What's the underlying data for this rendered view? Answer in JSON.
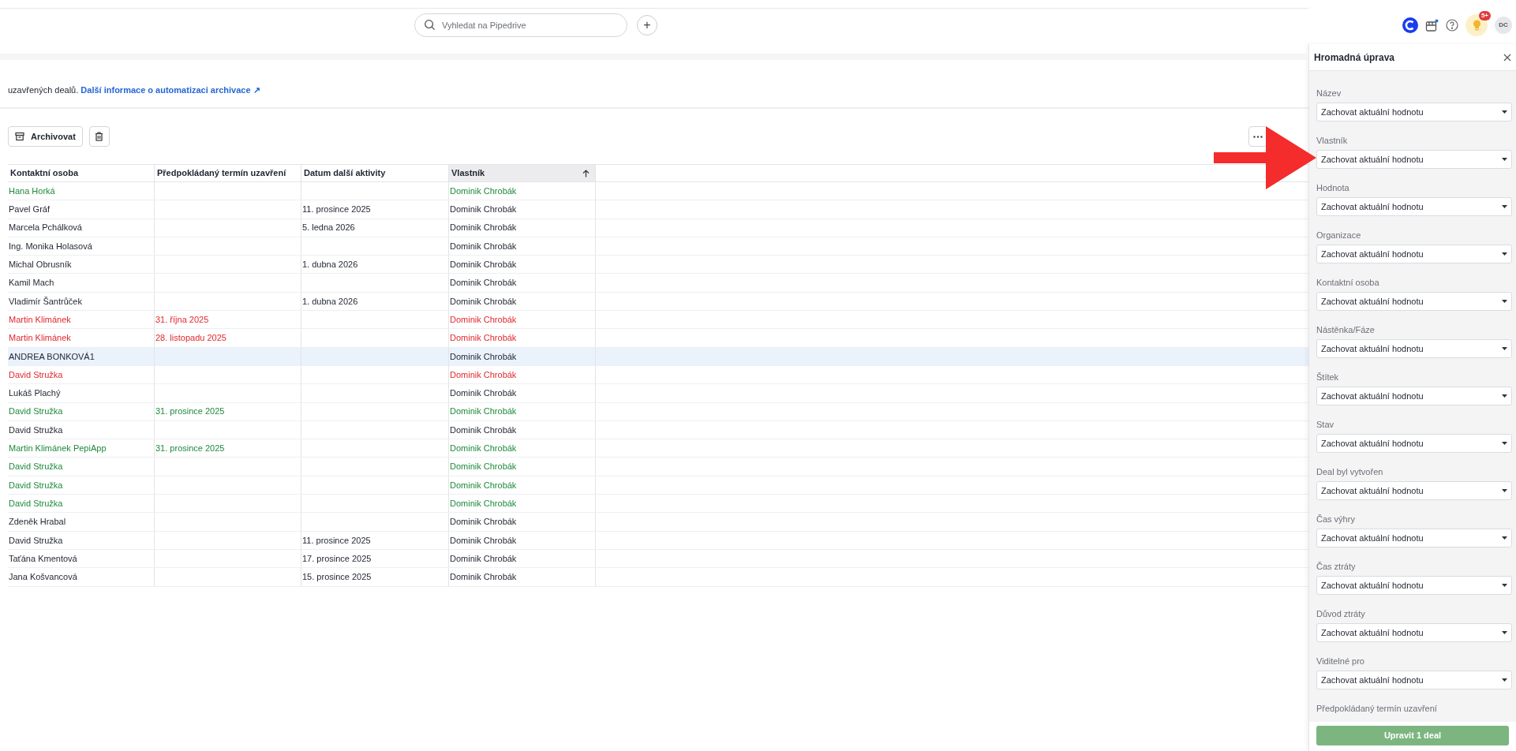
{
  "topbar": {
    "search": {
      "placeholder": "Vyhledat na Pipedrive"
    },
    "add_button": "+",
    "notification_badge": "5+",
    "avatar": "DC"
  },
  "banner": {
    "text": "uzavřených dealů.",
    "link": "Další informace o automatizaci archivace ↗"
  },
  "toolbar": {
    "archive_button": "Archivovat"
  },
  "table": {
    "columns": [
      {
        "label": "Kontaktní osoba",
        "sorted": false
      },
      {
        "label": "Předpokládaný termín uzavření",
        "sorted": false
      },
      {
        "label": "Datum další aktivity",
        "sorted": false
      },
      {
        "label": "Vlastník",
        "sorted": true
      }
    ],
    "rows": [
      {
        "color": "#1e8a3c",
        "selected": false,
        "cells": [
          "Hana Horká",
          "",
          "",
          "Dominik Chrobák"
        ]
      },
      {
        "color": "#1f2430",
        "selected": false,
        "cells": [
          "Pavel Gráf",
          "",
          "11. prosince 2025",
          "Dominik Chrobák"
        ]
      },
      {
        "color": "#1f2430",
        "selected": false,
        "cells": [
          "Marcela Pchálková",
          "",
          "5. ledna 2026",
          "Dominik Chrobák"
        ]
      },
      {
        "color": "#1f2430",
        "selected": false,
        "cells": [
          "Ing. Monika Holasová",
          "",
          "",
          "Dominik Chrobák"
        ]
      },
      {
        "color": "#1f2430",
        "selected": false,
        "cells": [
          "Michal Obrusník",
          "",
          "1. dubna 2026",
          "Dominik Chrobák"
        ]
      },
      {
        "color": "#1f2430",
        "selected": false,
        "cells": [
          "Kamil Mach",
          "",
          "",
          "Dominik Chrobák"
        ]
      },
      {
        "color": "#1f2430",
        "selected": false,
        "cells": [
          "Vladimír Šantrůček",
          "",
          "1. dubna 2026",
          "Dominik Chrobák"
        ]
      },
      {
        "color": "#e0282e",
        "selected": false,
        "cells": [
          "Martin Klimánek",
          "31. října 2025",
          "",
          "Dominik Chrobák"
        ]
      },
      {
        "color": "#e0282e",
        "selected": false,
        "cells": [
          "Martin Klimánek",
          "28. listopadu 2025",
          "",
          "Dominik Chrobák"
        ]
      },
      {
        "color": "#1f2430",
        "selected": true,
        "cells": [
          "ANDREA BONKOVÁ1",
          "",
          "",
          "Dominik Chrobák"
        ]
      },
      {
        "color": "#e0282e",
        "selected": false,
        "cells": [
          "David Stružka",
          "",
          "",
          "Dominik Chrobák"
        ]
      },
      {
        "color": "#1f2430",
        "selected": false,
        "cells": [
          "Lukáš Plachý",
          "",
          "",
          "Dominik Chrobák"
        ]
      },
      {
        "color": "#1e8a3c",
        "selected": false,
        "cells": [
          "David Stružka",
          "31. prosince 2025",
          "",
          "Dominik Chrobák"
        ]
      },
      {
        "color": "#1f2430",
        "selected": false,
        "cells": [
          "David Stružka",
          "",
          "",
          "Dominik Chrobák"
        ]
      },
      {
        "color": "#1e8a3c",
        "selected": false,
        "cells": [
          "Martin Klimánek PepiApp",
          "31. prosince 2025",
          "",
          "Dominik Chrobák"
        ]
      },
      {
        "color": "#1e8a3c",
        "selected": false,
        "cells": [
          "David Stružka",
          "",
          "",
          "Dominik Chrobák"
        ]
      },
      {
        "color": "#1e8a3c",
        "selected": false,
        "cells": [
          "David Stružka",
          "",
          "",
          "Dominik Chrobák"
        ]
      },
      {
        "color": "#1e8a3c",
        "selected": false,
        "cells": [
          "David Stružka",
          "",
          "",
          "Dominik Chrobák"
        ]
      },
      {
        "color": "#1f2430",
        "selected": false,
        "cells": [
          "Zdeněk Hrabal",
          "",
          "",
          "Dominik Chrobák"
        ]
      },
      {
        "color": "#1f2430",
        "selected": false,
        "cells": [
          "David Stružka",
          "",
          "11. prosince 2025",
          "Dominik Chrobák"
        ]
      },
      {
        "color": "#1f2430",
        "selected": false,
        "cells": [
          "Taťána Kmentová",
          "",
          "17. prosince 2025",
          "Dominik Chrobák"
        ]
      },
      {
        "color": "#1f2430",
        "selected": false,
        "cells": [
          "Jana Košvancová",
          "",
          "15. prosince 2025",
          "Dominik Chrobák"
        ]
      }
    ]
  },
  "panel": {
    "title": "Hromadná úprava",
    "fields": [
      {
        "label": "Název",
        "value": "Zachovat aktuální hodnotu"
      },
      {
        "label": "Vlastník",
        "value": "Zachovat aktuální hodnotu"
      },
      {
        "label": "Hodnota",
        "value": "Zachovat aktuální hodnotu"
      },
      {
        "label": "Organizace",
        "value": "Zachovat aktuální hodnotu"
      },
      {
        "label": "Kontaktní osoba",
        "value": "Zachovat aktuální hodnotu"
      },
      {
        "label": "Nástěnka/Fáze",
        "value": "Zachovat aktuální hodnotu"
      },
      {
        "label": "Štítek",
        "value": "Zachovat aktuální hodnotu"
      },
      {
        "label": "Stav",
        "value": "Zachovat aktuální hodnotu"
      },
      {
        "label": "Deal byl vytvořen",
        "value": "Zachovat aktuální hodnotu"
      },
      {
        "label": "Čas výhry",
        "value": "Zachovat aktuální hodnotu"
      },
      {
        "label": "Čas ztráty",
        "value": "Zachovat aktuální hodnotu"
      },
      {
        "label": "Důvod ztráty",
        "value": "Zachovat aktuální hodnotu"
      },
      {
        "label": "Viditelné pro",
        "value": "Zachovat aktuální hodnotu"
      },
      {
        "label": "Předpokládaný termín uzavření"
      }
    ],
    "submit_button": "Upravit 1 deal"
  }
}
